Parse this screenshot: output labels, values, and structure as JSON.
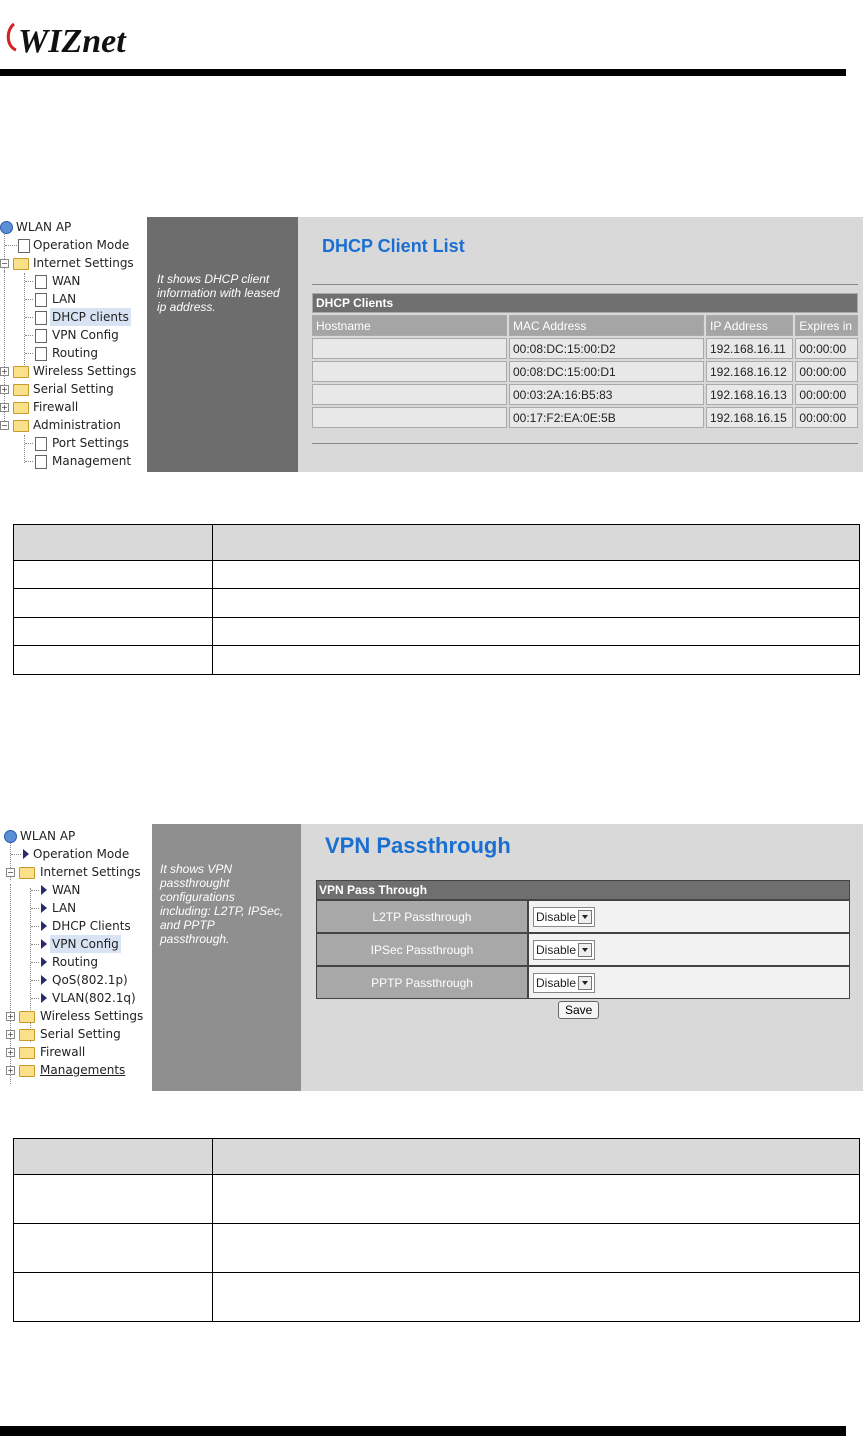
{
  "header": {
    "logo_text": "WIZnet"
  },
  "dhcp_panel": {
    "tree": {
      "root": "WLAN AP",
      "items": [
        "Operation Mode",
        "Internet Settings",
        "WAN",
        "LAN",
        "DHCP clients",
        "VPN Config",
        "Routing",
        "Wireless Settings",
        "Serial Setting",
        "Firewall",
        "Administration",
        "Port Settings",
        "Management"
      ]
    },
    "help_text": "It shows DHCP client information with leased ip address.",
    "title": "DHCP Client List",
    "table": {
      "caption": "DHCP Clients",
      "headers": [
        "Hostname",
        "MAC Address",
        "IP Address",
        "Expires in"
      ],
      "rows": [
        [
          "",
          "00:08:DC:15:00:D2",
          "192.168.16.11",
          "00:00:00"
        ],
        [
          "",
          "00:08:DC:15:00:D1",
          "192.168.16.12",
          "00:00:00"
        ],
        [
          "",
          "00:03:2A:16:B5:83",
          "192.168.16.13",
          "00:00:00"
        ],
        [
          "",
          "00:17:F2:EA:0E:5B",
          "192.168.16.15",
          "00:00:00"
        ]
      ]
    }
  },
  "vpn_panel": {
    "tree": {
      "root": "WLAN AP",
      "items": [
        "Operation Mode",
        "Internet Settings",
        "WAN",
        "LAN",
        "DHCP Clients",
        "VPN Config",
        "Routing",
        "QoS(802.1p)",
        "VLAN(802.1q)",
        "Wireless Settings",
        "Serial Setting",
        "Firewall",
        "Managements"
      ]
    },
    "help_text": "It shows VPN passthrought configurations including: L2TP, IPSec, and PPTP passthrough.",
    "title": "VPN Passthrough",
    "table": {
      "caption": "VPN Pass Through",
      "rows": [
        {
          "label": "L2TP Passthrough",
          "value": "Disable"
        },
        {
          "label": "IPSec Passthrough",
          "value": "Disable"
        },
        {
          "label": "PPTP Passthrough",
          "value": "Disable"
        }
      ]
    },
    "save_label": "Save"
  }
}
